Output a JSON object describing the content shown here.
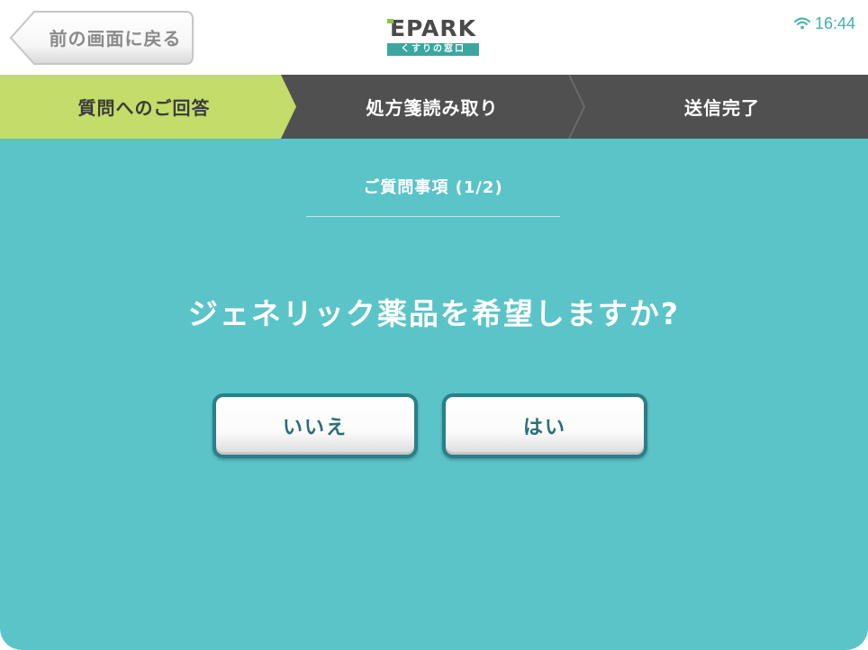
{
  "header": {
    "back_label": "前の画面に戻る",
    "logo_main": "EPARK",
    "logo_sub": "くすりの窓口",
    "time": "16:44",
    "wifi_icon": "wifi-icon"
  },
  "steps": [
    {
      "label": "質問へのご回答",
      "active": true
    },
    {
      "label": "処方箋読み取り",
      "active": false
    },
    {
      "label": "送信完了",
      "active": false
    }
  ],
  "main": {
    "counter": "ご質問事項 (1/2)",
    "question": "ジェネリック薬品を希望しますか?",
    "answers": {
      "no_label": "いいえ",
      "yes_label": "はい"
    }
  },
  "colors": {
    "accent_teal": "#5bc4c8",
    "step_active": "#c3dc6a",
    "step_inactive": "#505050",
    "button_border": "#2a7f8a",
    "brand_green": "#8dc63f"
  }
}
